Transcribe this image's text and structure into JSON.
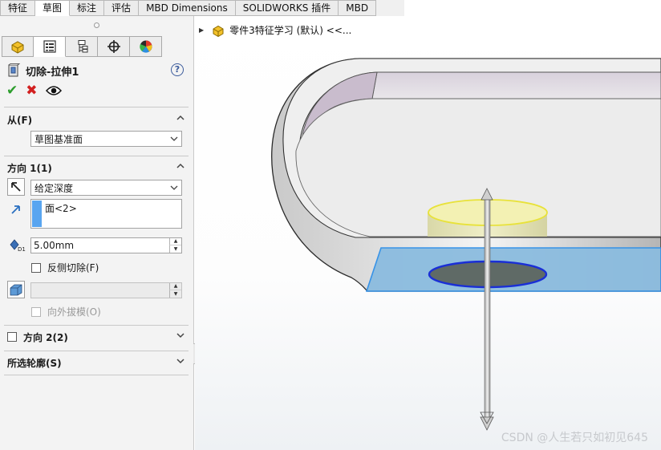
{
  "top_tabs": [
    "特征",
    "草图",
    "标注",
    "评估",
    "MBD Dimensions",
    "SOLIDWORKS 插件",
    "MBD"
  ],
  "active_tab_index": 1,
  "manager_tabs": [
    {
      "icon": "feature-manager-icon"
    },
    {
      "icon": "property-manager-icon"
    },
    {
      "icon": "configuration-manager-icon"
    },
    {
      "icon": "dimxpert-manager-icon"
    },
    {
      "icon": "display-manager-icon"
    }
  ],
  "feature": {
    "title": "切除-拉伸1",
    "help": "?"
  },
  "from_section": {
    "label": "从(F)",
    "selected": "草图基准面"
  },
  "direction1": {
    "label": "方向 1(1)",
    "end_condition": "给定深度",
    "selection_item": "面<2>",
    "depth_value": "5.00mm",
    "flip_side_label": "反侧切除(F)",
    "draft_label": "向外拔模(O)"
  },
  "direction2": {
    "label": "方向 2(2)"
  },
  "selected_contours": {
    "label": "所选轮廓(S)"
  },
  "viewport": {
    "tree_node_label": "零件3特征学习 (默认) <<..."
  },
  "watermark": "CSDN @人生若只如初见645",
  "colors": {
    "accent_blue": "#59a5f0",
    "ok_green": "#2c9d2c",
    "cancel_red": "#d21f1f",
    "face_highlight": "#8bbcdf",
    "sketch_circle": "#1a2fd6",
    "preview_yellow": "#e6e17a"
  }
}
